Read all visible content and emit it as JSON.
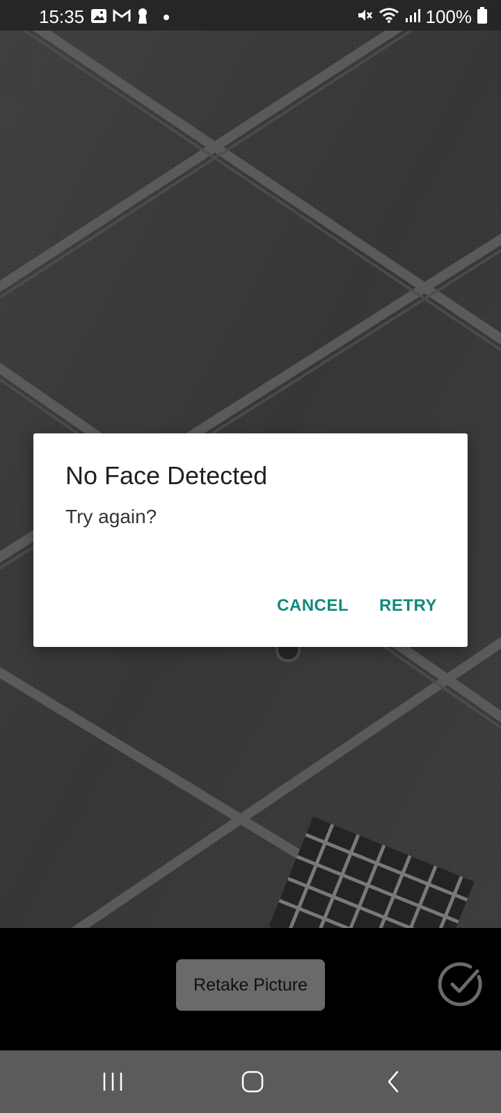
{
  "status_bar": {
    "time": "15:35",
    "battery_text": "100%",
    "left_icons": [
      "gallery-icon",
      "gmail-icon",
      "keyhole-icon",
      "dot-icon"
    ],
    "right_icons": [
      "mute-icon",
      "wifi-icon",
      "signal-icon",
      "battery-icon"
    ]
  },
  "dialog": {
    "title": "No Face Detected",
    "message": "Try again?",
    "cancel_label": "CANCEL",
    "retry_label": "RETRY"
  },
  "controls": {
    "retake_label": "Retake Picture",
    "confirm_icon": "check-circle-icon"
  },
  "nav_bar": {
    "icons": [
      "recents-icon",
      "home-icon",
      "back-icon"
    ]
  },
  "colors": {
    "accent": "#0f8a7c",
    "status_bar": "#262626",
    "nav_bar": "#5b5b5b",
    "dialog_bg": "#ffffff"
  }
}
